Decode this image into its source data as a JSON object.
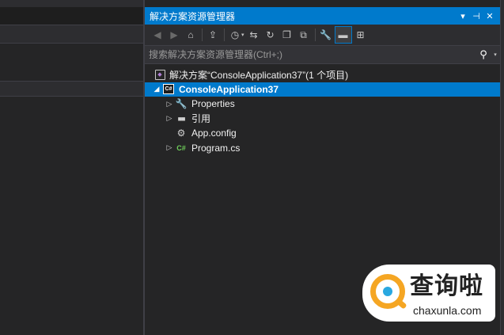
{
  "solution_explorer": {
    "title": "解决方案资源管理器",
    "title_buttons": {
      "dropdown_glyph": "▾",
      "pin_glyph": "⊣",
      "close_glyph": "✕"
    },
    "toolbar": {
      "back_icon": "◀",
      "forward_icon": "▶",
      "home_icon": "⌂",
      "pending_icon": "⇪",
      "history_icon": "◷",
      "sync_icon": "⇆",
      "refresh_icon": "↻",
      "collapse_icon": "❐",
      "show_all_icon": "⧉",
      "properties_icon": "🔧",
      "preview_icon": "▬",
      "diagram_icon": "⊞"
    },
    "search": {
      "placeholder": "搜索解决方案资源管理器(Ctrl+;)",
      "icon": "⚲"
    },
    "tree": {
      "solution": {
        "label": "解决方案“ConsoleApplication37”(1 个项目)"
      },
      "project": {
        "label": "ConsoleApplication37",
        "expanded_glyph": "◢",
        "icon_text": "C#"
      },
      "items": [
        {
          "label": "Properties",
          "arrow": "▷",
          "icon": "🔧"
        },
        {
          "label": "引用",
          "arrow": "▷",
          "icon": "■■"
        },
        {
          "label": "App.config",
          "arrow": "",
          "icon": "⚙"
        },
        {
          "label": "Program.cs",
          "arrow": "▷",
          "icon": "C#"
        }
      ]
    }
  },
  "watermark": {
    "name": "查询啦",
    "url": "chaxunla.com"
  }
}
